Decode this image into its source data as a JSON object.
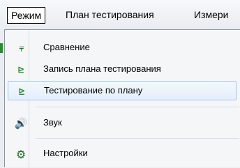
{
  "menubar": {
    "items": [
      {
        "label": "Режим",
        "active": true
      },
      {
        "label": "План тестирования"
      },
      {
        "label": "Измери"
      }
    ]
  },
  "menu": {
    "items": [
      {
        "label": "Сравнение",
        "icon": "compare-icon",
        "glyph": "⫧"
      },
      {
        "label": "Запись плана тестирования",
        "icon": "record-plan-icon",
        "glyph": "⊵"
      },
      {
        "label": "Тестирование по плану",
        "icon": "test-by-plan-icon",
        "glyph": "⊵",
        "highlighted": true
      },
      {
        "label": "Звук",
        "icon": "speaker-icon",
        "glyph": "🔊"
      },
      {
        "label": "Настройки",
        "icon": "gear-icon",
        "glyph": "⚙"
      }
    ]
  },
  "colors": {
    "accent_icon": "#2e8b34",
    "hover_border": "#a9c4e6",
    "hover_background": "#e4eefb"
  }
}
